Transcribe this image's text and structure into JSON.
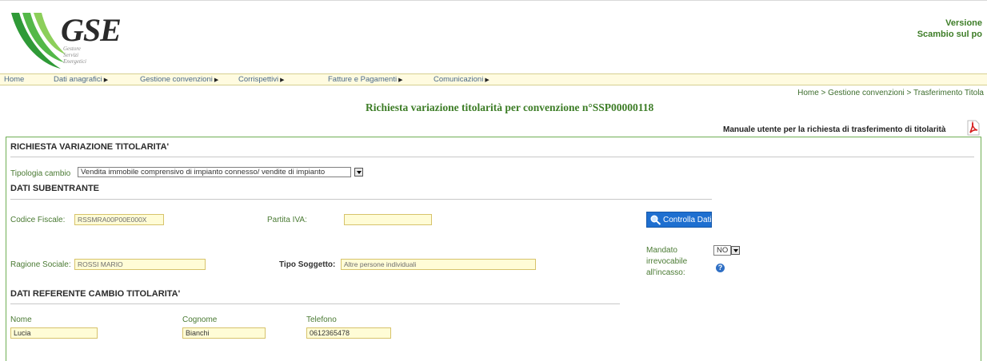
{
  "header": {
    "logo_text": "GSE",
    "logo_sub": [
      "Gestore",
      "Servizi",
      "Energetici"
    ],
    "version_line1": "Versione",
    "version_line2": "Scambio sul po"
  },
  "nav": [
    {
      "label": "Home",
      "arrow": false
    },
    {
      "label": "Dati anagrafici",
      "arrow": true
    },
    {
      "label": "Gestione convenzioni",
      "arrow": true
    },
    {
      "label": "Corrispettivi",
      "arrow": true
    },
    {
      "label": "Fatture e Pagamenti",
      "arrow": true
    },
    {
      "label": "Comunicazioni",
      "arrow": true
    }
  ],
  "breadcrumb": "Home > Gestione convenzioni > Trasferimento Titola",
  "page_title": "Richiesta variazione titolarità per convenzione n°SSP00000118",
  "manual_link": "Manuale utente per la richiesta di trasferimento di titolarità",
  "section_main": "RICHIESTA VARIAZIONE TITOLARITA'",
  "tipologia": {
    "label": "Tipologia cambio",
    "value": "Vendita immobile comprensivo di impianto connesso/ vendite di impianto"
  },
  "subentrante": {
    "title": "DATI SUBENTRANTE",
    "codice_fiscale_label": "Codice Fiscale:",
    "codice_fiscale_value": "RSSMRA00P00E000X",
    "partita_iva_label": "Partita IVA:",
    "partita_iva_value": "",
    "controlla_label": "Controlla Dati",
    "ragione_label": "Ragione Sociale:",
    "ragione_value": "ROSSI MARIO",
    "tipo_label": "Tipo Soggetto:",
    "tipo_value": "Altre persone individuali",
    "mandato_label_1": "Mandato",
    "mandato_label_2": "irrevocabile",
    "mandato_label_3": "all'incasso:",
    "mandato_value": "NO"
  },
  "referente": {
    "title": "DATI REFERENTE CAMBIO TITOLARITA'",
    "nome_label": "Nome",
    "nome_value": "Lucia",
    "cognome_label": "Cognome",
    "cognome_value": "Bianchi",
    "telefono_label": "Telefono",
    "telefono_value": "0612365478"
  },
  "colors": {
    "accent_green": "#3d7d27",
    "panel_border": "#6fae54",
    "input_bg": "#fffcd6",
    "button_blue": "#1e6fd0"
  },
  "icons": [
    "gse-logo",
    "pdf-icon",
    "search-icon",
    "help-icon",
    "chevron-down-icon"
  ]
}
